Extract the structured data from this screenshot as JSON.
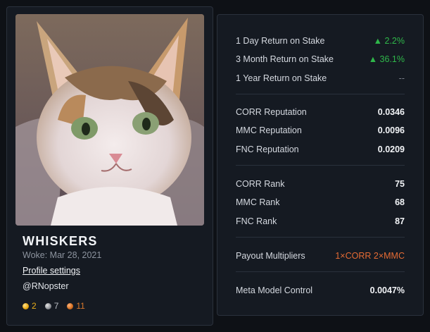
{
  "profile": {
    "username": "WHISKERS",
    "woke": "Woke: Mar 28, 2021",
    "settings_link": "Profile settings",
    "handle": "@RNopster",
    "medals": [
      {
        "type": "gold",
        "count": "2",
        "color": "#e9ae1a"
      },
      {
        "type": "silver",
        "count": "7",
        "color": "#b8bcc3"
      },
      {
        "type": "bronze",
        "count": "11",
        "color": "#d8772c"
      }
    ]
  },
  "stats": {
    "returns": [
      {
        "label": "1 Day Return on Stake",
        "value": "▲ 2.2%"
      },
      {
        "label": "3 Month Return on Stake",
        "value": "▲ 36.1%"
      },
      {
        "label": "1 Year Return on Stake",
        "value": "--"
      }
    ],
    "reputation": [
      {
        "label": "CORR Reputation",
        "value": "0.0346"
      },
      {
        "label": "MMC Reputation",
        "value": "0.0096"
      },
      {
        "label": "FNC Reputation",
        "value": "0.0209"
      }
    ],
    "rank": [
      {
        "label": "CORR Rank",
        "value": "75"
      },
      {
        "label": "MMC Rank",
        "value": "68"
      },
      {
        "label": "FNC Rank",
        "value": "87"
      }
    ],
    "payout": {
      "label": "Payout Multipliers",
      "value": "1×CORR 2×MMC"
    },
    "meta": {
      "label": "Meta Model Control",
      "value": "0.0047%"
    }
  },
  "colors": {
    "positive": "#2fb74a",
    "multiplier": "#e56b34",
    "card_bg": "#151a22",
    "page_bg": "#0e1116"
  }
}
